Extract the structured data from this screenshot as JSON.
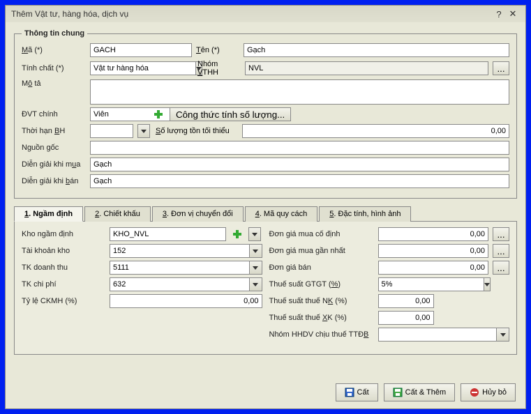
{
  "window": {
    "title": "Thêm Vật tư, hàng hóa, dịch vụ"
  },
  "general": {
    "legend": "Thông tin chung",
    "ma_label": "Mã (*)",
    "ma": "GACH",
    "ten_label": "Tên (*)",
    "ten": "Gạch",
    "tinhchat_label": "Tính chất (*)",
    "tinhchat": "Vật tư hàng hóa",
    "nhom_label": "Nhóm VTHH",
    "nhom": "NVL",
    "mota_label": "Mô tả",
    "mota": "",
    "dvt_label": "ĐVT chính",
    "dvt": "Viên",
    "congthuc_btn": "Công thức tính số lượng...",
    "thoihanbh_label": "Thời hạn BH",
    "thoihanbh": "",
    "sltoithieu_label": "Số lượng tồn tối thiểu",
    "sltoithieu": "0,00",
    "nguongoc_label": "Nguồn gốc",
    "nguongoc": "",
    "diengiai_mua_label": "Diễn giải khi mua",
    "diengiai_mua": "Gạch",
    "diengiai_ban_label": "Diễn giải khi bán",
    "diengiai_ban": "Gạch"
  },
  "tabs": {
    "t1": "1. Ngầm định",
    "t2": "2. Chiết khấu",
    "t3": "3. Đơn vị chuyển đổi",
    "t4": "4. Mã quy cách",
    "t5": "5. Đặc tính, hình ảnh"
  },
  "ngamdinh": {
    "kho_label": "Kho ngầm định",
    "kho": "KHO_NVL",
    "tkkho_label": "Tài khoản kho",
    "tkkho": "152",
    "tkdt_label": "TK doanh thu",
    "tkdt": "5111",
    "tkcp_label": "TK chi phí",
    "tkcp": "632",
    "tyleckmh_label": "Tỷ lệ CKMH (%)",
    "tyleckmh": "0,00",
    "dongiamuacd_label": "Đơn giá mua cố định",
    "dongiamuacd": "0,00",
    "dongiamuagn_label": "Đơn giá mua gần nhất",
    "dongiamuagn": "0,00",
    "dongiaban_label": "Đơn giá bán",
    "dongiaban": "0,00",
    "tsgtgt_label": "Thuế suất GTGT (%)",
    "tsgtgt": "5%",
    "tsnk_label": "Thuế suất thuế NK (%)",
    "tsnk": "0,00",
    "tsxk_label": "Thuế suất thuế XK (%)",
    "tsxk": "0,00",
    "nhomttdb_label": "Nhóm HHDV chịu thuế TTĐB",
    "nhomttdb": ""
  },
  "footer": {
    "cat": "Cất",
    "catthem": "Cất & Thêm",
    "huybo": "Hủy bỏ"
  }
}
